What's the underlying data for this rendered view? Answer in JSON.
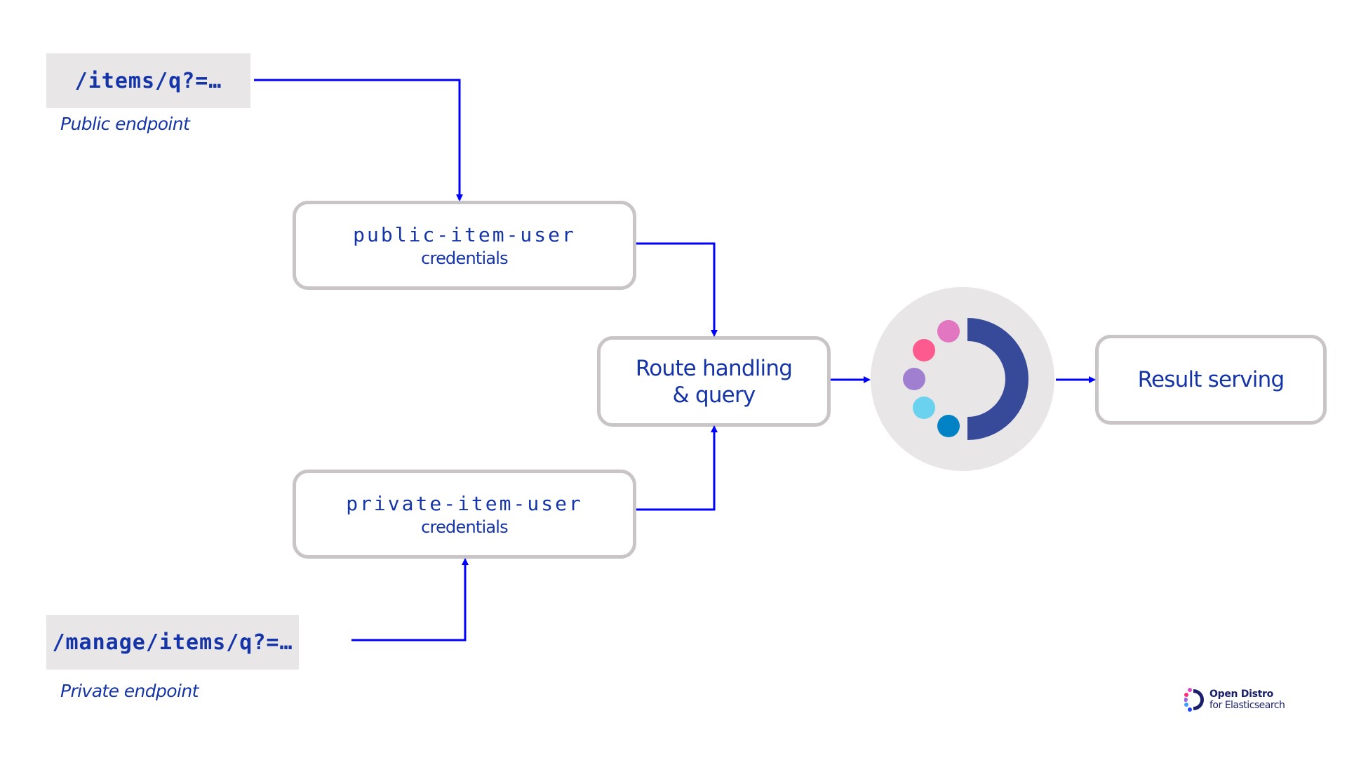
{
  "endpoints": {
    "public": {
      "path": "/items/q?=…",
      "caption": "Public endpoint"
    },
    "private": {
      "path": "/manage/items/q?=…",
      "caption": "Private endpoint"
    }
  },
  "nodes": {
    "public_user": {
      "name": "public-item-user",
      "sub": "credentials"
    },
    "private_user": {
      "name": "private-item-user",
      "sub": "credentials"
    },
    "route": {
      "line1": "Route handling",
      "line2": "& query"
    },
    "result": {
      "label": "Result serving"
    }
  },
  "engine": {
    "icon": "open-distro-logo-icon",
    "colors": {
      "background": "#e8e6e7",
      "ring": "#374a9a",
      "dots": [
        "#e276c0",
        "#fd5b8f",
        "#a07fd0",
        "#6ad2ef",
        "#0082c4"
      ]
    }
  },
  "connector_color": "#0000ff",
  "text_color": "#1534a8",
  "branding": {
    "line1": "Open Distro",
    "line2": "for Elasticsearch"
  }
}
